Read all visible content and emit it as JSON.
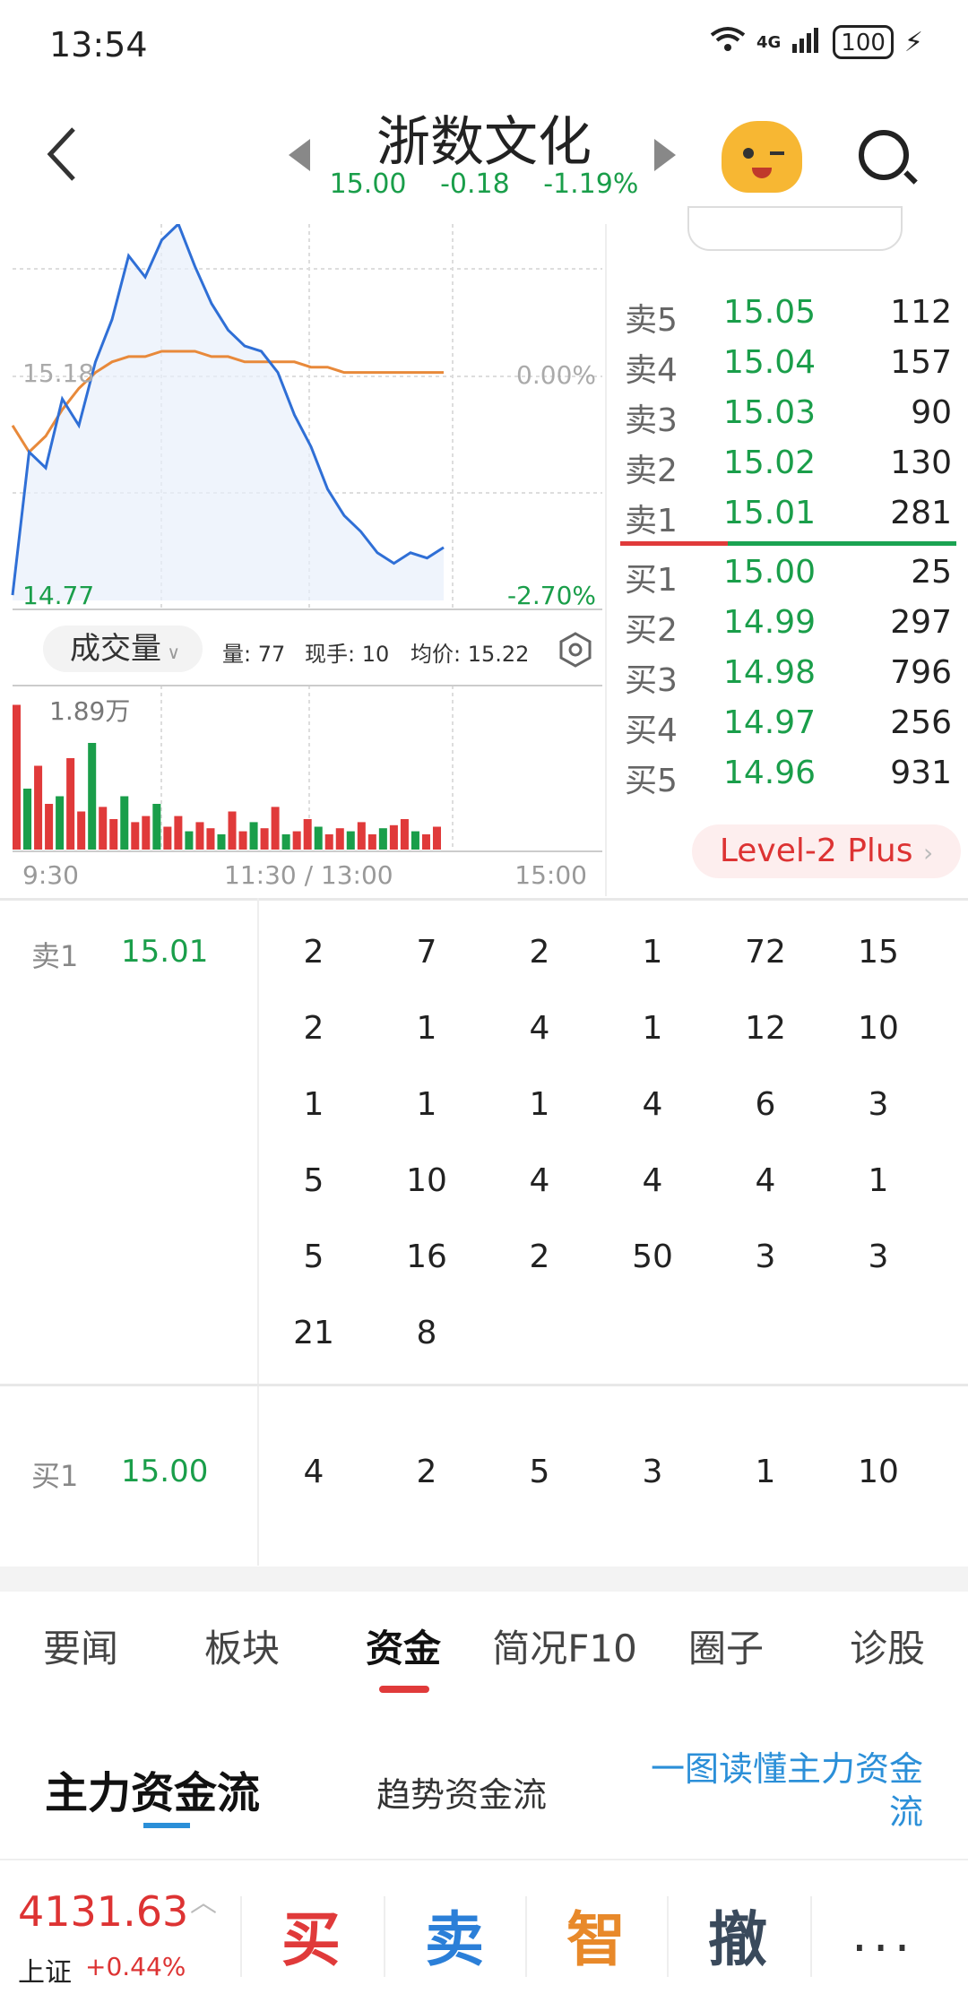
{
  "status": {
    "time": "13:54",
    "network": "4G",
    "battery": "100"
  },
  "header": {
    "title": "浙数文化",
    "price": "15.00",
    "change": "-0.18",
    "change_pct": "-1.19%"
  },
  "chart": {
    "y_left_top": "15.18",
    "y_left_bottom": "14.77",
    "y_right_top": "0.00%",
    "y_right_bottom": "-2.70%",
    "vol_button": "成交量",
    "vol_qty_label": "量: 77",
    "vol_hand_label": "现手: 10",
    "vol_avg_label": "均价: 15.22",
    "vol_max": "1.89万",
    "time_start": "9:30",
    "time_mid": "11:30 / 13:00",
    "time_end": "15:00"
  },
  "chart_data": {
    "type": "line",
    "series": [
      {
        "values": [
          14.78,
          15.05,
          15.02,
          15.15,
          15.1,
          15.22,
          15.3,
          15.42,
          15.38,
          15.45,
          15.48,
          15.4,
          15.33,
          15.28,
          15.25,
          15.24,
          15.2,
          15.12,
          15.06,
          14.98,
          14.93,
          14.9,
          14.86,
          14.84,
          14.86,
          14.85,
          14.87
        ]
      },
      {
        "values": [
          15.1,
          15.05,
          15.08,
          15.13,
          15.17,
          15.2,
          15.22,
          15.23,
          15.23,
          15.24,
          15.24,
          15.24,
          15.23,
          15.23,
          15.22,
          15.22,
          15.22,
          15.22,
          15.21,
          15.21,
          15.2,
          15.2,
          15.2,
          15.2,
          15.2,
          15.2,
          15.2
        ]
      }
    ],
    "ylim": [
      14.77,
      15.18
    ],
    "volumes": [
      95,
      40,
      55,
      30,
      35,
      60,
      25,
      70,
      28,
      20,
      35,
      18,
      22,
      30,
      15,
      22,
      12,
      18,
      14,
      10,
      25,
      12,
      18,
      14,
      28,
      10,
      12,
      20,
      15,
      10,
      14,
      12,
      18,
      10,
      14,
      16,
      20,
      12,
      10,
      15
    ]
  },
  "orderbook": {
    "sell": [
      {
        "label": "卖5",
        "price": "15.05",
        "vol": "112"
      },
      {
        "label": "卖4",
        "price": "15.04",
        "vol": "157"
      },
      {
        "label": "卖3",
        "price": "15.03",
        "vol": "90"
      },
      {
        "label": "卖2",
        "price": "15.02",
        "vol": "130"
      },
      {
        "label": "卖1",
        "price": "15.01",
        "vol": "281"
      }
    ],
    "buy": [
      {
        "label": "买1",
        "price": "15.00",
        "vol": "25"
      },
      {
        "label": "买2",
        "price": "14.99",
        "vol": "297"
      },
      {
        "label": "买3",
        "price": "14.98",
        "vol": "796"
      },
      {
        "label": "买4",
        "price": "14.97",
        "vol": "256"
      },
      {
        "label": "买5",
        "price": "14.96",
        "vol": "931"
      }
    ],
    "level2": "Level-2 Plus"
  },
  "queue": {
    "sell_label": "卖1",
    "sell_price": "15.01",
    "sell_rows": [
      [
        "2",
        "7",
        "2",
        "1",
        "72",
        "15"
      ],
      [
        "2",
        "1",
        "4",
        "1",
        "12",
        "10"
      ],
      [
        "1",
        "1",
        "1",
        "4",
        "6",
        "3"
      ],
      [
        "5",
        "10",
        "4",
        "4",
        "4",
        "1"
      ],
      [
        "5",
        "16",
        "2",
        "50",
        "3",
        "3"
      ],
      [
        "21",
        "8"
      ]
    ],
    "buy_label": "买1",
    "buy_price": "15.00",
    "buy_rows": [
      [
        "4",
        "2",
        "5",
        "3",
        "1",
        "10"
      ]
    ]
  },
  "tabs": [
    "要闻",
    "板块",
    "资金",
    "简况F10",
    "圈子",
    "诊股"
  ],
  "subtabs": {
    "main": "主力资金流",
    "trend": "趋势资金流",
    "guide": "一图读懂主力资金流"
  },
  "bottom": {
    "index_value": "4131.63",
    "index_name": "上证",
    "index_pct": "+0.44%",
    "buy": "买",
    "sell": "卖",
    "smart": "智",
    "cancel": "撤",
    "more": "..."
  },
  "colors": {
    "up": "#e03a3a",
    "down": "#1a9e4a",
    "price_line": "#2f6fd6",
    "avg_line": "#e8893a",
    "accent": "#2b8fd8"
  }
}
